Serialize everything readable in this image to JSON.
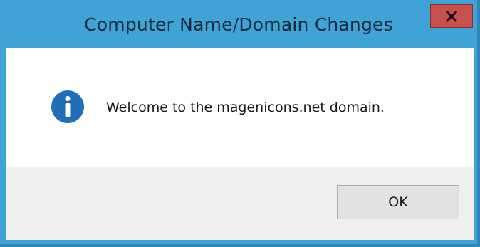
{
  "window": {
    "title": "Computer Name/Domain Changes",
    "close_icon": "close-icon"
  },
  "dialog": {
    "icon": "info-icon",
    "message": "Welcome to the magenicons.net domain.",
    "ok_label": "OK"
  },
  "colors": {
    "frame": "#3fa3d6",
    "close_button": "#c9514a",
    "info_icon": "#1f6fb8",
    "footer": "#f0f0f0"
  }
}
